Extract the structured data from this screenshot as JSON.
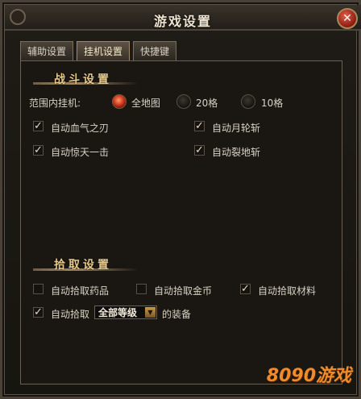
{
  "window": {
    "title": "游戏设置",
    "close": "✕"
  },
  "tabs": [
    {
      "label": "辅助设置",
      "active": false
    },
    {
      "label": "挂机设置",
      "active": true
    },
    {
      "label": "快捷键",
      "active": false
    }
  ],
  "combat": {
    "title": "战斗设置",
    "range_label": "范围内挂机:",
    "radios": [
      {
        "label": "全地图",
        "checked": true
      },
      {
        "label": "20格",
        "checked": false
      },
      {
        "label": "10格",
        "checked": false
      }
    ],
    "checks": [
      {
        "label": "自动血气之刃",
        "checked": true
      },
      {
        "label": "自动月轮斩",
        "checked": true
      },
      {
        "label": "自动惊天一击",
        "checked": true
      },
      {
        "label": "自动裂地斩",
        "checked": true
      }
    ]
  },
  "pickup": {
    "title": "拾取设置",
    "checks": [
      {
        "label": "自动拾取药品",
        "checked": false
      },
      {
        "label": "自动拾取金币",
        "checked": false
      },
      {
        "label": "自动拾取材料",
        "checked": true
      }
    ],
    "auto_pick": {
      "label": "自动拾取",
      "checked": true,
      "grade": "全部等级",
      "suffix": "的装备"
    }
  },
  "watermark": "8090游戏",
  "colors": {
    "accent": "#e8c88a",
    "radio_on": "#d2371e",
    "watermark": "#f08a2a"
  }
}
